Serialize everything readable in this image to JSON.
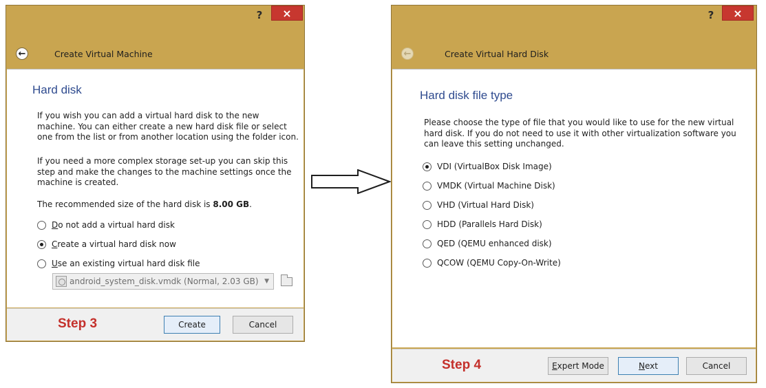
{
  "step3_dialog": {
    "help_label": "?",
    "close_label": "×",
    "header_title": "Create Virtual Machine",
    "section_title": "Hard disk",
    "para1_line1": "If you wish you can add a virtual hard disk to the new",
    "para1_line2": "machine. You can either create a new hard disk file or select",
    "para1_line3": "one from the list or from another location using the folder icon.",
    "para2_line1": "If you need a more complex storage set-up you can skip this",
    "para2_line2": "step and make the changes to the machine settings once the",
    "para2_line3": "machine is created.",
    "recommended_text": "The recommended size of the hard disk is",
    "recommended_size": "8.00 GB",
    "recommended_end": ".",
    "options": [
      {
        "accel": "D",
        "rest": "o not add a virtual hard disk",
        "checked": false
      },
      {
        "accel": "C",
        "rest": "reate a virtual hard disk now",
        "checked": true
      },
      {
        "accel": "U",
        "rest": "se an existing virtual hard disk file",
        "checked": false
      }
    ],
    "disk_combo_value": "android_system_disk.vmdk (Normal, 2.03 GB)",
    "step_label": "Step 3",
    "create_label": "Create",
    "cancel_label": "Cancel"
  },
  "step4_dialog": {
    "help_label": "?",
    "close_label": "×",
    "header_title": "Create Virtual Hard Disk",
    "section_title": "Hard disk file type",
    "para_line1": "Please choose the type of file that you would like to use for the new virtual",
    "para_line2": "hard disk. If you do not need to use it with other virtualization software you",
    "para_line3": "can leave this setting unchanged.",
    "options": [
      {
        "label": "VDI (VirtualBox Disk Image)",
        "checked": true
      },
      {
        "label": "VMDK (Virtual Machine Disk)",
        "checked": false
      },
      {
        "label": "VHD (Virtual Hard Disk)",
        "checked": false
      },
      {
        "label": "HDD (Parallels Hard Disk)",
        "checked": false
      },
      {
        "label": "QED (QEMU enhanced disk)",
        "checked": false
      },
      {
        "label": "QCOW (QEMU Copy-On-Write)",
        "checked": false
      }
    ],
    "step_label": "Step 4",
    "expert_accel": "E",
    "expert_rest": "xpert Mode",
    "next_accel": "N",
    "next_rest": "ext",
    "cancel_label": "Cancel"
  },
  "colors": {
    "window_frame": "#c9a550",
    "close_button": "#c7372f",
    "section_title": "#2f4b8f",
    "step_label": "#c4302b"
  },
  "icons": [
    "back-arrow-icon",
    "close-icon",
    "help-icon",
    "hard-disk-icon",
    "folder-icon",
    "dropdown-arrow-icon",
    "right-arrow-icon"
  ]
}
